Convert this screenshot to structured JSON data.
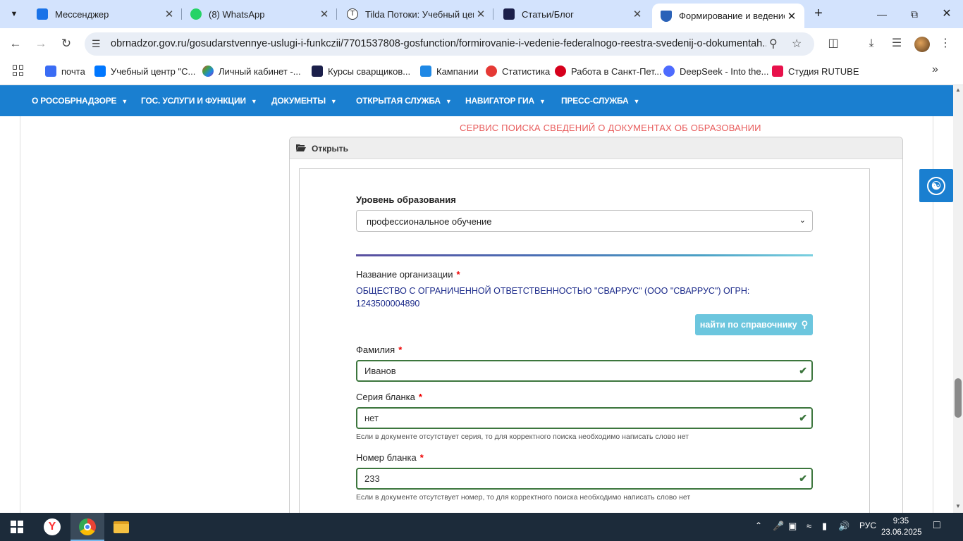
{
  "browser": {
    "tabs": [
      {
        "title": "Мессенджер",
        "favicon": "messenger-icon",
        "color": "#1a73e8"
      },
      {
        "title": "(8) WhatsApp",
        "favicon": "whatsapp-icon",
        "color": "#25d366"
      },
      {
        "title": "Tilda Потоки: Учебный цен",
        "favicon": "tilda-icon",
        "color": "#333333"
      },
      {
        "title": "Статьи/Блог",
        "favicon": "blog-icon",
        "color": "#1b1f4a"
      },
      {
        "title": "Формирование и ведение ",
        "favicon": "obrnadzor-icon",
        "color": "#2a62b8",
        "active": true
      }
    ],
    "url": "obrnadzor.gov.ru/gosudarstvennye-uslugi-i-funkczii/7701537808-gosfunction/formirovanie-i-vedenie-federalnogo-reestra-svedenij-o-dokumentah...",
    "bookmarks": [
      {
        "label": "почта",
        "favicon": "mail-icon",
        "color": "#3a6cf4"
      },
      {
        "label": "Учебный центр \"С...",
        "favicon": "vk-icon",
        "color": "#0077ff"
      },
      {
        "label": "Личный кабинет -...",
        "favicon": "cabinet-icon",
        "color": "#9c27b0"
      },
      {
        "label": "Курсы сварщиков...",
        "favicon": "courses-icon",
        "color": "#1b1f4a"
      },
      {
        "label": "Кампании",
        "favicon": "campaigns-icon",
        "color": "#1e88e5"
      },
      {
        "label": "Статистика",
        "favicon": "stats-icon",
        "color": "#e53935"
      },
      {
        "label": "Работа в Санкт-Пет...",
        "favicon": "hh-icon",
        "color": "#d6001c"
      },
      {
        "label": "DeepSeek - Into the...",
        "favicon": "deepseek-icon",
        "color": "#4d6bfe"
      },
      {
        "label": "Студия RUTUBE",
        "favicon": "rutube-icon",
        "color": "#e8114b"
      }
    ]
  },
  "site": {
    "nav": [
      {
        "label": "О РОСОБРНАДЗОРЕ"
      },
      {
        "label": "ГОС. УСЛУГИ И ФУНКЦИИ"
      },
      {
        "label": "ДОКУМЕНТЫ"
      },
      {
        "label": "ОТКРЫТАЯ СЛУЖБА"
      },
      {
        "label": "НАВИГАТОР ГИА"
      },
      {
        "label": "ПРЕСС-СЛУЖБА"
      }
    ],
    "service_title": "СЕРВИС ПОИСКА СВЕДЕНИЙ О ДОКУМЕНТАХ ОБ ОБРАЗОВАНИИ",
    "accordion_label": "Открыть"
  },
  "form": {
    "education_level_label": "Уровень образования",
    "education_level_value": "профессиональное обучение",
    "org_label": "Название организации",
    "org_value": "ОБЩЕСТВО С ОГРАНИЧЕННОЙ ОТВЕТСТВЕННОСТЬЮ \"СВАРРУС\" (ООО \"СВАРРУС\") ОГРН: 1243500004890",
    "find_button": "найти по справочнику",
    "surname_label": "Фамилия",
    "surname_value": "Иванов",
    "series_label": "Серия бланка",
    "series_value": "нет",
    "series_hint": "Если в документе отсутствует серия, то для корректного поиска необходимо написать слово нет",
    "number_label": "Номер бланка",
    "number_value": "233",
    "number_hint": "Если в документе отсутствует номер, то для корректного поиска необходимо написать слово нет",
    "required_mark": "*"
  },
  "taskbar": {
    "language": "РУС",
    "time": "9:35",
    "date": "23.06.2025"
  }
}
